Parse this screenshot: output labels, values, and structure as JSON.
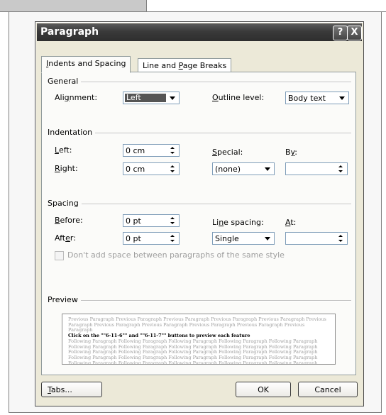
{
  "dialog": {
    "title": "Paragraph",
    "help_glyph": "?",
    "close_glyph": "X",
    "tabs": [
      {
        "label": "Indents and Spacing",
        "accel": "I",
        "rest": "ndents and Spacing"
      },
      {
        "label": "Line and Page Breaks",
        "pre": "Line and ",
        "accel": "P",
        "rest": "age Breaks"
      }
    ]
  },
  "general": {
    "label": "General",
    "alignment_label": {
      "pre": "Ali",
      "accel": "g",
      "rest": "nment:"
    },
    "alignment_value": "Left",
    "outline_label": {
      "accel": "O",
      "rest": "utline level:"
    },
    "outline_value": "Body text"
  },
  "indentation": {
    "label": "Indentation",
    "left_label": {
      "accel": "L",
      "rest": "eft:"
    },
    "left_value": "0 cm",
    "right_label": {
      "accel": "R",
      "rest": "ight:"
    },
    "right_value": "0 cm",
    "special_label": {
      "accel": "S",
      "rest": "pecial:"
    },
    "special_value": "(none)",
    "by_label": {
      "pre": "B",
      "accel": "y",
      "rest": ":"
    },
    "by_value": ""
  },
  "spacing": {
    "label": "Spacing",
    "before_label": {
      "accel": "B",
      "rest": "efore:"
    },
    "before_value": "0 pt",
    "after_label": {
      "pre": "Aft",
      "accel": "e",
      "rest": "r:"
    },
    "after_value": "0 pt",
    "line_spacing_label": {
      "pre": "Li",
      "accel": "n",
      "rest": "e spacing:"
    },
    "line_spacing_value": "Single",
    "at_label": {
      "accel": "A",
      "rest": "t:"
    },
    "at_value": "",
    "no_space_checkbox": "Don't add space between paragraphs of the same style"
  },
  "preview": {
    "label": "Preview",
    "previous_text": "Previous Paragraph Previous Paragraph Previous Paragraph Previous Paragraph Previous Paragraph Previous Paragraph Previous Paragraph Previous Paragraph Previous Paragraph Previous Paragraph Previous Paragraph",
    "current_text": "Click on the \"\"6-11-6\"\" and \"\"6-11-7\"\" buttons to preview each feature",
    "following_text": "Following Paragraph Following Paragraph Following Paragraph Following Paragraph Following Paragraph Following Paragraph Following Paragraph Following Paragraph Following Paragraph Following Paragraph Following Paragraph Following Paragraph Following Paragraph Following Paragraph Following Paragraph Following Paragraph Following Paragraph Following Paragraph Following Paragraph Following Paragraph Following Paragraph Following Paragraph Following Paragraph Following Paragraph Following Paragraph Following Paragraph Following Paragraph Following Paragraph"
  },
  "buttons": {
    "tabs": {
      "accel": "T",
      "rest": "abs..."
    },
    "ok": "OK",
    "cancel": "Cancel"
  }
}
